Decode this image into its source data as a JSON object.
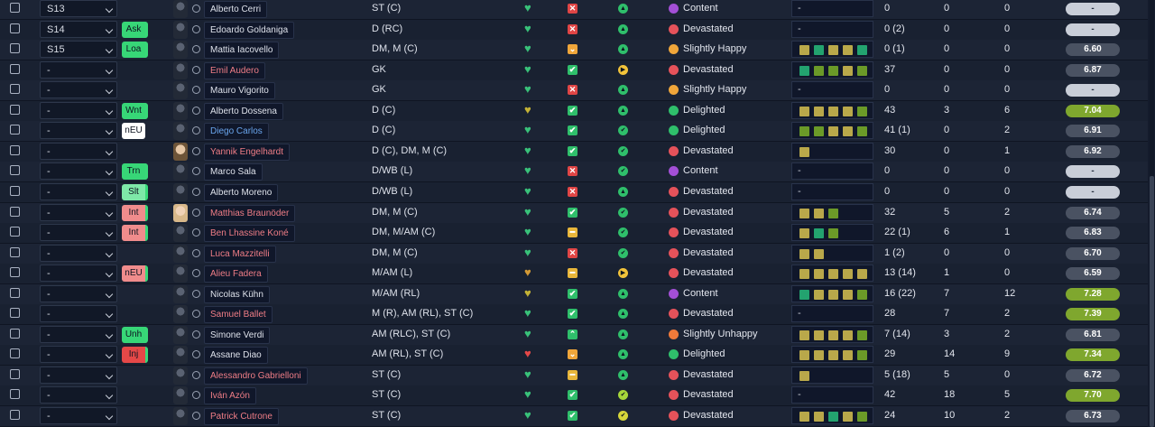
{
  "rows": [
    {
      "sel": "S13",
      "role": "",
      "role_color": "",
      "face": "sil",
      "name": "Alberto Cerri",
      "name_color": "white",
      "pos": "ST (C)",
      "heart": "#39c27a",
      "sq": "x",
      "dot": "#2fbf6b",
      "dot_sym": "▲",
      "morale_color": "#a34fd6",
      "morale": "Content",
      "form": [],
      "apps": "0",
      "goals": "0",
      "assists": "0",
      "rating": "-",
      "rating_bg": "#c9ced8",
      "rating_fg": "#263040"
    },
    {
      "sel": "S14",
      "role": "Ask",
      "role_color": "#37d677",
      "face": "sil",
      "name": "Edoardo Goldaniga",
      "name_color": "white",
      "pos": "D (RC)",
      "heart": "#39c27a",
      "sq": "x",
      "dot": "#2fbf6b",
      "dot_sym": "▲",
      "morale_color": "#e5525a",
      "morale": "Devastated",
      "form": [],
      "apps": "0 (2)",
      "goals": "0",
      "assists": "0",
      "rating": "-",
      "rating_bg": "#c9ced8",
      "rating_fg": "#263040"
    },
    {
      "sel": "S15",
      "role": "Loa",
      "role_color": "#37d677",
      "face": "sil",
      "name": "Mattia Iacovello",
      "name_color": "white",
      "pos": "DM, M (C)",
      "heart": "#39c27a",
      "sq": "v",
      "dot": "#2fbf6b",
      "dot_sym": "▲",
      "morale_color": "#f0a63a",
      "morale": "Slightly Happy",
      "form": [
        "#b9a84a",
        "#23a36f",
        "#b9a84a",
        "#b9a84a",
        "#23a36f"
      ],
      "apps": "0 (1)",
      "goals": "0",
      "assists": "0",
      "rating": "6.60",
      "rating_bg": "#4a5262",
      "rating_fg": "#fff"
    },
    {
      "sel": "-",
      "role": "",
      "role_color": "",
      "face": "sil",
      "name": "Emil Audero",
      "name_color": "red",
      "pos": "GK",
      "heart": "#39c27a",
      "sq": "ok",
      "dot": "#f2c33a",
      "dot_sym": "▶",
      "morale_color": "#e5525a",
      "morale": "Devastated",
      "form": [
        "#23a36f",
        "#6b9a28",
        "#6b9a28",
        "#b9a84a",
        "#6b9a28"
      ],
      "apps": "37",
      "goals": "0",
      "assists": "0",
      "rating": "6.87",
      "rating_bg": "#4a5262",
      "rating_fg": "#fff"
    },
    {
      "sel": "-",
      "role": "",
      "role_color": "",
      "face": "sil",
      "name": "Mauro Vigorito",
      "name_color": "white",
      "pos": "GK",
      "heart": "#39c27a",
      "sq": "x",
      "dot": "#2fbf6b",
      "dot_sym": "▲",
      "morale_color": "#f0a63a",
      "morale": "Slightly Happy",
      "form": [],
      "apps": "0",
      "goals": "0",
      "assists": "0",
      "rating": "-",
      "rating_bg": "#c9ced8",
      "rating_fg": "#263040"
    },
    {
      "sel": "-",
      "role": "Wnt",
      "role_color": "#37d677",
      "face": "sil",
      "name": "Alberto Dossena",
      "name_color": "white",
      "pos": "D (C)",
      "heart": "#c4b336",
      "sq": "ok",
      "dot": "#2fbf6b",
      "dot_sym": "▲",
      "morale_color": "#2fbf6b",
      "morale": "Delighted",
      "form": [
        "#b9a84a",
        "#b9a84a",
        "#b9a84a",
        "#b9a84a",
        "#6b9a28"
      ],
      "apps": "43",
      "goals": "3",
      "assists": "6",
      "rating": "7.04",
      "rating_bg": "#7fa72e",
      "rating_fg": "#fff"
    },
    {
      "sel": "-",
      "role": "nEU",
      "role_color": "#ffffff",
      "face": "sil",
      "name": "Diego Carlos",
      "name_color": "blue",
      "pos": "D (C)",
      "heart": "#39c27a",
      "sq": "ok",
      "dot": "#2fbf6b",
      "dot_sym": "✔",
      "morale_color": "#2fbf6b",
      "morale": "Delighted",
      "form": [
        "#6b9a28",
        "#6b9a28",
        "#b9a84a",
        "#b9a84a",
        "#6b9a28"
      ],
      "apps": "41 (1)",
      "goals": "0",
      "assists": "2",
      "rating": "6.91",
      "rating_bg": "#4a5262",
      "rating_fg": "#fff"
    },
    {
      "sel": "-",
      "role": "",
      "role_color": "",
      "face": "photo",
      "name": "Yannik Engelhardt",
      "name_color": "red",
      "pos": "D (C), DM, M (C)",
      "heart": "#39c27a",
      "sq": "ok",
      "dot": "#2fbf6b",
      "dot_sym": "✔",
      "morale_color": "#e5525a",
      "morale": "Devastated",
      "form": [
        "#b9a84a"
      ],
      "apps": "30",
      "goals": "0",
      "assists": "1",
      "rating": "6.92",
      "rating_bg": "#4a5262",
      "rating_fg": "#fff"
    },
    {
      "sel": "-",
      "role": "Trn",
      "role_color": "#37d677",
      "face": "sil",
      "name": "Marco Sala",
      "name_color": "white",
      "pos": "D/WB (L)",
      "heart": "#39c27a",
      "sq": "x",
      "dot": "#2fbf6b",
      "dot_sym": "✔",
      "morale_color": "#a34fd6",
      "morale": "Content",
      "form": [],
      "apps": "0",
      "goals": "0",
      "assists": "0",
      "rating": "-",
      "rating_bg": "#c9ced8",
      "rating_fg": "#263040"
    },
    {
      "sel": "-",
      "role": "Slt",
      "role_color": "#7ee8a8",
      "face": "sil",
      "name": "Alberto Moreno",
      "name_color": "white",
      "pos": "D/WB (L)",
      "heart": "#39c27a",
      "sq": "x",
      "dot": "#2fbf6b",
      "dot_sym": "▲",
      "morale_color": "#e5525a",
      "morale": "Devastated",
      "form": [],
      "apps": "0",
      "goals": "0",
      "assists": "0",
      "rating": "-",
      "rating_bg": "#c9ced8",
      "rating_fg": "#263040"
    },
    {
      "sel": "-",
      "role": "Int",
      "role_color": "#f08c8c",
      "face": "photo2",
      "name": "Matthias Braunöder",
      "name_color": "red",
      "pos": "DM, M (C)",
      "heart": "#39c27a",
      "sq": "ok",
      "dot": "#2fbf6b",
      "dot_sym": "✔",
      "morale_color": "#e5525a",
      "morale": "Devastated",
      "form": [
        "#b9a84a",
        "#b9a84a",
        "#6b9a28"
      ],
      "apps": "32",
      "goals": "5",
      "assists": "2",
      "rating": "6.74",
      "rating_bg": "#4a5262",
      "rating_fg": "#fff"
    },
    {
      "sel": "-",
      "role": "Int",
      "role_color": "#f08c8c",
      "face": "sil",
      "name": "Ben Lhassine Koné",
      "name_color": "red",
      "pos": "DM, M/AM (C)",
      "heart": "#39c27a",
      "sq": "mid",
      "dot": "#2fbf6b",
      "dot_sym": "✔",
      "morale_color": "#e5525a",
      "morale": "Devastated",
      "form": [
        "#b9a84a",
        "#23a36f",
        "#6b9a28"
      ],
      "apps": "22 (1)",
      "goals": "6",
      "assists": "1",
      "rating": "6.83",
      "rating_bg": "#4a5262",
      "rating_fg": "#fff"
    },
    {
      "sel": "-",
      "role": "",
      "role_color": "",
      "face": "sil",
      "name": "Luca Mazzitelli",
      "name_color": "red",
      "pos": "DM, M (C)",
      "heart": "#39c27a",
      "sq": "x",
      "dot": "#2fbf6b",
      "dot_sym": "✔",
      "morale_color": "#e5525a",
      "morale": "Devastated",
      "form": [
        "#b9a84a",
        "#b9a84a"
      ],
      "apps": "1 (2)",
      "goals": "0",
      "assists": "0",
      "rating": "6.70",
      "rating_bg": "#4a5262",
      "rating_fg": "#fff"
    },
    {
      "sel": "-",
      "role": "nEU",
      "role_color": "#f08c8c",
      "face": "sil",
      "name": "Alieu Fadera",
      "name_color": "red",
      "pos": "M/AM (L)",
      "heart": "#d49a36",
      "sq": "mid",
      "dot": "#f2c33a",
      "dot_sym": "▶",
      "morale_color": "#e5525a",
      "morale": "Devastated",
      "form": [
        "#b9a84a",
        "#b9a84a",
        "#b9a84a",
        "#b9a84a",
        "#b9a84a"
      ],
      "apps": "13 (14)",
      "goals": "1",
      "assists": "0",
      "rating": "6.59",
      "rating_bg": "#4a5262",
      "rating_fg": "#fff"
    },
    {
      "sel": "-",
      "role": "",
      "role_color": "",
      "face": "sil",
      "name": "Nicolas Kühn",
      "name_color": "white",
      "pos": "M/AM (RL)",
      "heart": "#c4b336",
      "sq": "ok",
      "dot": "#2fbf6b",
      "dot_sym": "▲",
      "morale_color": "#a34fd6",
      "morale": "Content",
      "form": [
        "#23a36f",
        "#b9a84a",
        "#b9a84a",
        "#b9a84a",
        "#6b9a28"
      ],
      "apps": "16 (22)",
      "goals": "7",
      "assists": "12",
      "rating": "7.28",
      "rating_bg": "#7fa72e",
      "rating_fg": "#fff"
    },
    {
      "sel": "-",
      "role": "",
      "role_color": "",
      "face": "sil",
      "name": "Samuel Ballet",
      "name_color": "red",
      "pos": "M (R), AM (RL), ST (C)",
      "heart": "#39c27a",
      "sq": "ok",
      "dot": "#2fbf6b",
      "dot_sym": "▲",
      "morale_color": "#e5525a",
      "morale": "Devastated",
      "form": [],
      "apps": "28",
      "goals": "7",
      "assists": "2",
      "rating": "7.39",
      "rating_bg": "#7fa72e",
      "rating_fg": "#fff"
    },
    {
      "sel": "-",
      "role": "Unh",
      "role_color": "#37d677",
      "face": "sil",
      "name": "Simone Verdi",
      "name_color": "white",
      "pos": "AM (RLC), ST (C)",
      "heart": "#39c27a",
      "sq": "up",
      "dot": "#2fbf6b",
      "dot_sym": "▲",
      "morale_color": "#f07a3a",
      "morale": "Slightly Unhappy",
      "form": [
        "#b9a84a",
        "#b9a84a",
        "#b9a84a",
        "#b9a84a",
        "#6b9a28"
      ],
      "apps": "7 (14)",
      "goals": "3",
      "assists": "2",
      "rating": "6.81",
      "rating_bg": "#4a5262",
      "rating_fg": "#fff"
    },
    {
      "sel": "-",
      "role": "Inj",
      "role_color": "#e54848",
      "face": "sil",
      "name": "Assane Diao",
      "name_color": "white",
      "pos": "AM (RL), ST (C)",
      "heart": "#e54848",
      "sq": "v",
      "dot": "#2fbf6b",
      "dot_sym": "▲",
      "morale_color": "#2fbf6b",
      "morale": "Delighted",
      "form": [
        "#b9a84a",
        "#b9a84a",
        "#b9a84a",
        "#b9a84a",
        "#6b9a28"
      ],
      "apps": "29",
      "goals": "14",
      "assists": "9",
      "rating": "7.34",
      "rating_bg": "#7fa72e",
      "rating_fg": "#fff"
    },
    {
      "sel": "-",
      "role": "",
      "role_color": "",
      "face": "sil",
      "name": "Alessandro Gabrielloni",
      "name_color": "red",
      "pos": "ST (C)",
      "heart": "#39c27a",
      "sq": "mid",
      "dot": "#2fbf6b",
      "dot_sym": "▲",
      "morale_color": "#e5525a",
      "morale": "Devastated",
      "form": [
        "#b9a84a"
      ],
      "apps": "5 (18)",
      "goals": "5",
      "assists": "0",
      "rating": "6.72",
      "rating_bg": "#4a5262",
      "rating_fg": "#fff"
    },
    {
      "sel": "-",
      "role": "",
      "role_color": "",
      "face": "sil",
      "name": "Iván Azón",
      "name_color": "red",
      "pos": "ST (C)",
      "heart": "#39c27a",
      "sq": "ok",
      "dot": "#a6d63a",
      "dot_sym": "✔",
      "morale_color": "#e5525a",
      "morale": "Devastated",
      "form": [],
      "apps": "42",
      "goals": "18",
      "assists": "5",
      "rating": "7.70",
      "rating_bg": "#7fa72e",
      "rating_fg": "#fff"
    },
    {
      "sel": "-",
      "role": "",
      "role_color": "",
      "face": "sil",
      "name": "Patrick Cutrone",
      "name_color": "red",
      "pos": "ST (C)",
      "heart": "#39c27a",
      "sq": "ok",
      "dot": "#d6d63a",
      "dot_sym": "✔",
      "morale_color": "#e5525a",
      "morale": "Devastated",
      "form": [
        "#b9a84a",
        "#b9a84a",
        "#23a36f",
        "#b9a84a",
        "#6b9a28"
      ],
      "apps": "24",
      "goals": "10",
      "assists": "2",
      "rating": "6.73",
      "rating_bg": "#4a5262",
      "rating_fg": "#fff"
    }
  ]
}
